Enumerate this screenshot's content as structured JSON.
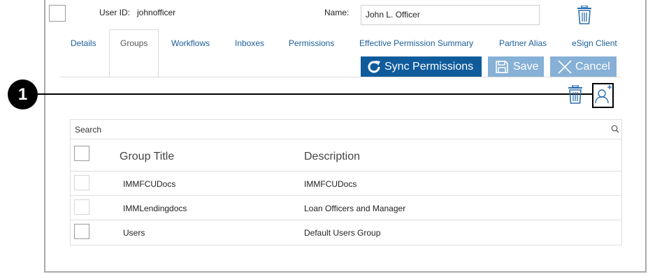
{
  "header": {
    "user_id_label": "User ID:",
    "user_id_value": "johnofficer",
    "name_label": "Name:",
    "name_value": "John L. Officer"
  },
  "tabs": [
    {
      "label": "Details",
      "active": false
    },
    {
      "label": "Groups",
      "active": true
    },
    {
      "label": "Workflows",
      "active": false
    },
    {
      "label": "Inboxes",
      "active": false
    },
    {
      "label": "Permissions",
      "active": false
    },
    {
      "label": "Effective Permission Summary",
      "active": false
    },
    {
      "label": "Partner Alias",
      "active": false
    },
    {
      "label": "eSign Client",
      "active": false
    }
  ],
  "toolbar": {
    "sync_label": "Sync Permissions",
    "save_label": "Save",
    "cancel_label": "Cancel"
  },
  "callout": {
    "number": "1"
  },
  "search": {
    "placeholder": "Search"
  },
  "table": {
    "columns": [
      "Group Title",
      "Description"
    ],
    "rows": [
      {
        "title": "IMMFCUDocs",
        "description": "IMMFCUDocs"
      },
      {
        "title": "IMMLendingdocs",
        "description": "Loan Officers and Manager"
      },
      {
        "title": "Users",
        "description": "Default Users Group"
      }
    ]
  },
  "colors": {
    "primary": "#0f5b9c",
    "primary_disabled": "#86b0d6",
    "link": "#1b5f9a",
    "icon_blue": "#2f6fb0"
  },
  "icons": [
    "trash-icon",
    "sync-icon",
    "save-icon",
    "close-icon",
    "add-user-icon",
    "search-icon"
  ]
}
